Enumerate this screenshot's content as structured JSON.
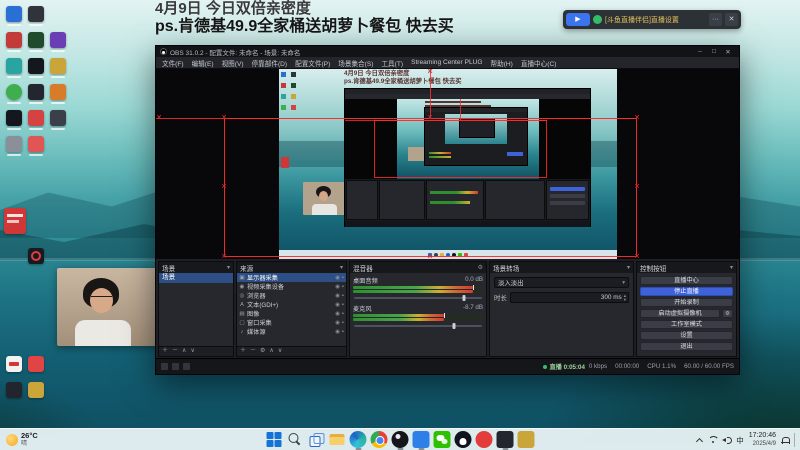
{
  "overlay": {
    "line1": "4月9日 今日双倍亲密度",
    "line2": "ps.肯德基49.9全家桶送胡萝卜餐包 快去买"
  },
  "douyu_bar": {
    "play_glyph": "▶",
    "text": "[斗鱼直播伴侣]直播设置",
    "more_glyph": "···",
    "close_glyph": "✕"
  },
  "obs": {
    "title_bar": {
      "title": "OBS 31.0.2 - 配置文件: 未命名 - 场景: 未命名",
      "minimize": "–",
      "maximize": "□",
      "close": "✕"
    },
    "menu_items": [
      "文件(F)",
      "编辑(E)",
      "视图(V)",
      "停靠部件(D)",
      "配置文件(P)",
      "场景集合(S)",
      "工具(T)",
      "Streaming Center PLUG",
      "帮助(H)",
      "直播中心(C)"
    ],
    "icons": {
      "gear": "⚙",
      "caret_down": "▾",
      "eye": "◉",
      "lock": "▪",
      "plus": "＋",
      "minus": "－",
      "up": "∧",
      "down": "∨",
      "spin_up": "▴",
      "spin_down": "▾",
      "speaker": "◁",
      "handle": "✕"
    },
    "scenes": {
      "title": "场景",
      "items": [
        {
          "name": "场景",
          "selected": true
        }
      ]
    },
    "sources": {
      "title": "来源",
      "items": [
        {
          "glyph": "▣",
          "name": "显示器采集",
          "selected": true
        },
        {
          "glyph": "◉",
          "name": "视频采集设备"
        },
        {
          "glyph": "◎",
          "name": "浏览器"
        },
        {
          "glyph": "A",
          "name": "文本(GDI+)"
        },
        {
          "glyph": "▤",
          "name": "图像"
        },
        {
          "glyph": "▢",
          "name": "窗口采集"
        },
        {
          "glyph": "♪",
          "name": "媒体源"
        }
      ]
    },
    "mixer": {
      "title": "混音器",
      "channels": [
        {
          "name": "桌面音频",
          "db": "0.0 dB",
          "fill": "92%",
          "slider": "86%"
        },
        {
          "name": "麦克风",
          "db": "-8.7 dB",
          "fill": "70%",
          "slider": "78%"
        }
      ]
    },
    "transition": {
      "title": "场景转场",
      "selected": "淡入淡出",
      "duration_label": "时长",
      "duration": "300 ms"
    },
    "controls": {
      "title": "控制按钮",
      "buttons": [
        {
          "label": "直播中心",
          "variant": "default"
        },
        {
          "label": "停止直播",
          "variant": "primary"
        },
        {
          "label": "开始录制",
          "variant": "default"
        },
        {
          "label": "启动虚拟摄像机",
          "variant": "split"
        },
        {
          "label": "工作室模式",
          "variant": "default"
        },
        {
          "label": "设置",
          "variant": "default"
        },
        {
          "label": "退出",
          "variant": "default"
        }
      ]
    },
    "statusbar": {
      "stream_label": "直播 0:05:04",
      "items": [
        "0 kbps",
        "00:00:00",
        "CPU 1.1%",
        "60.00 / 60.00 FPS"
      ]
    }
  },
  "taskbar": {
    "weather": {
      "temp": "26°C",
      "desc": "晴"
    },
    "tray": {
      "lang": "中",
      "time": "17:20:46",
      "date": "2025/4/9"
    }
  },
  "colors": {
    "accent_blue": "#3e63d9",
    "selection_red": "#ff2b2b",
    "meter_green": "#2f8f2f",
    "stream_green": "#37c06b"
  }
}
